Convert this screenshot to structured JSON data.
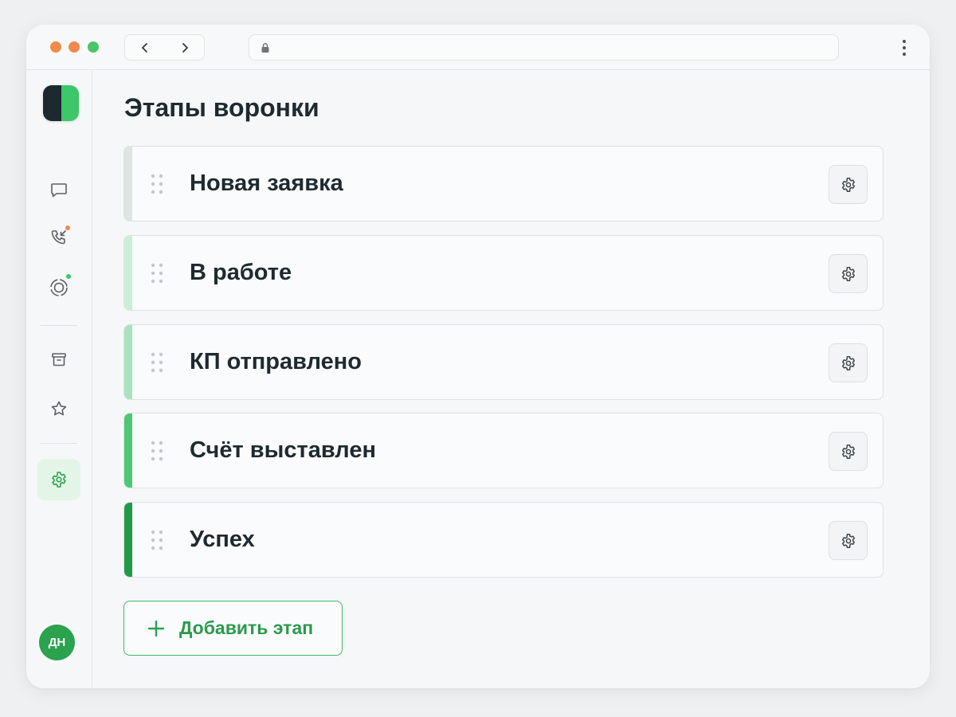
{
  "window": {
    "controls": [
      "close",
      "minimize",
      "maximize"
    ],
    "nav": {
      "back_icon": "chevron-left-icon",
      "forward_icon": "chevron-right-icon"
    },
    "address": {
      "icon": "lock-icon",
      "value": ""
    },
    "menu_icon": "more-vertical-icon"
  },
  "sidebar": {
    "logo": "app-logo",
    "items": [
      {
        "icon": "chat-icon"
      },
      {
        "icon": "phone-incoming-icon",
        "badge_color": "#f08a4c"
      },
      {
        "icon": "target-icon",
        "badge_color": "#3ec76a"
      },
      {
        "icon": "archive-icon"
      },
      {
        "icon": "star-icon"
      },
      {
        "icon": "gear-icon",
        "active": true
      }
    ],
    "avatar": "ДН"
  },
  "main": {
    "title": "Этапы воронки",
    "stages": [
      {
        "name": "Новая заявка",
        "color": "#dfe6e2"
      },
      {
        "name": "В работе",
        "color": "#cdeed6"
      },
      {
        "name": "КП отправлено",
        "color": "#a9e3bb"
      },
      {
        "name": "Счёт выставлен",
        "color": "#4cc877"
      },
      {
        "name": "Успех",
        "color": "#22994a"
      }
    ],
    "add_stage_label": "Добавить этап"
  },
  "colors": {
    "accent": "#2aa24e",
    "text": "#1e2a30"
  }
}
